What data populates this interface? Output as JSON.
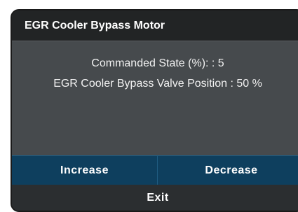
{
  "dialog": {
    "title": "EGR Cooler Bypass Motor",
    "status": {
      "commanded_state": "Commanded State (%): : 5",
      "valve_position": "EGR Cooler Bypass Valve Position : 50 %"
    },
    "buttons": {
      "increase_label": "Increase",
      "decrease_label": "Decrease",
      "exit_label": "Exit"
    }
  },
  "colors": {
    "title_bar": "#222425",
    "body": "#464a4d",
    "button_row": "#0e3f5e",
    "exit_row": "#2b2e30",
    "text": "#ffffff"
  }
}
